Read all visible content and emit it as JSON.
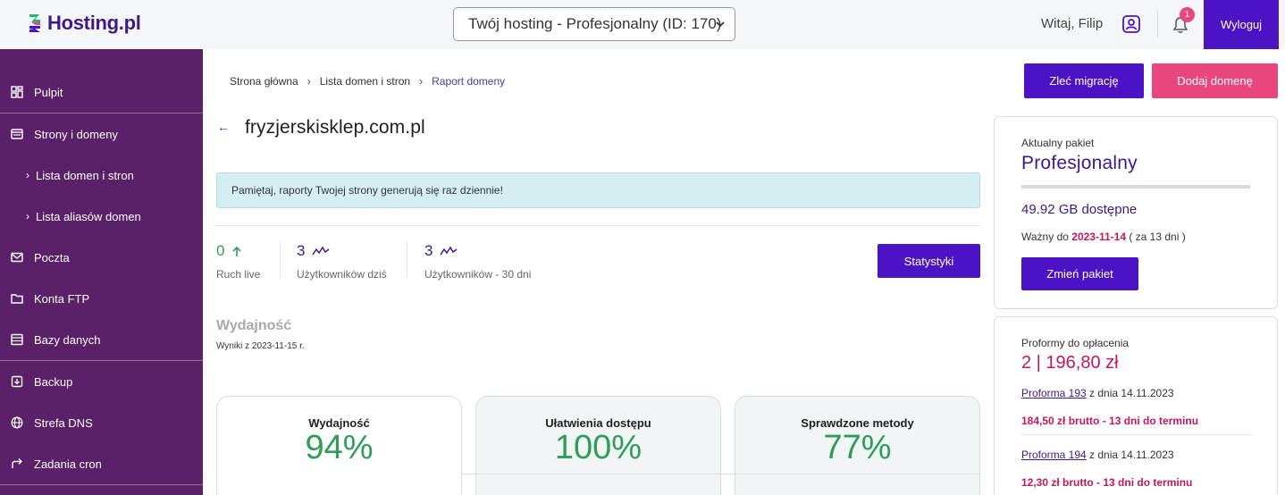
{
  "header": {
    "logo_text": "Hosting.pl",
    "hosting_select": "Twój hosting - Profesjonalny (ID: 170)",
    "greeting": "Witaj, Filip",
    "notifications_count": "1",
    "logout_label": "Wyloguj"
  },
  "sidebar": {
    "items": [
      {
        "label": "Pulpit",
        "icon": "dashboard-icon"
      },
      {
        "label": "Strony i domeny",
        "icon": "pages-icon"
      },
      {
        "label": "Lista domen i stron",
        "icon": "chevron-right-icon"
      },
      {
        "label": "Lista aliasów domen",
        "icon": "chevron-right-icon"
      },
      {
        "label": "Poczta",
        "icon": "mail-icon"
      },
      {
        "label": "Konta FTP",
        "icon": "folder-icon"
      },
      {
        "label": "Bazy danych",
        "icon": "database-icon"
      },
      {
        "label": "Backup",
        "icon": "backup-icon"
      },
      {
        "label": "Strefa DNS",
        "icon": "globe-icon"
      },
      {
        "label": "Zadania cron",
        "icon": "redirect-icon"
      }
    ]
  },
  "breadcrumb": {
    "home": "Strona główna",
    "list": "Lista domen i stron",
    "current": "Raport domeny"
  },
  "actions": {
    "migration_label": "Zleć migrację",
    "add_domain_label": "Dodaj domenę"
  },
  "domain": {
    "name": "fryzjerskisklep.com.pl",
    "notice": "Pamiętaj, raporty Twojej strony generują się raz dziennie!"
  },
  "stats": {
    "live_value": "0",
    "live_caption": "Ruch live",
    "today_value": "3",
    "today_caption": "Użytkowników dziś",
    "month_value": "3",
    "month_caption": "Użytkowników - 30 dni",
    "button_label": "Statystyki"
  },
  "performance": {
    "title": "Wydajność",
    "date": "Wyniki z 2023-11-15 r.",
    "scores": [
      {
        "label": "Wydajność",
        "value": "94%"
      },
      {
        "label": "Ułatwienia dostępu",
        "value": "100%"
      },
      {
        "label": "Sprawdzone metody",
        "value": "77%"
      }
    ]
  },
  "plan": {
    "label": "Aktualny pakiet",
    "name": "Profesjonalny",
    "usage_fraction": 0,
    "space": "49.92 GB dostępne",
    "valid_prefix": "Ważny do",
    "valid_date": "2023-11-14",
    "valid_suffix": "( za 13 dni )",
    "change_label": "Zmień pakiet"
  },
  "proforma": {
    "label": "Proformy do opłacenia",
    "total": "2 | 196,80 zł",
    "items": [
      {
        "link": "Proforma 193",
        "date": "z dnia 14.11.2023",
        "amount": "184,50 zł brutto - 13 dni do terminu"
      },
      {
        "link": "Proforma 194",
        "date": "z dnia 14.11.2023",
        "amount": "12,30 zł brutto - 13 dni do terminu"
      }
    ]
  },
  "colors": {
    "brand": "#4c13c4",
    "sidebar": "#5a2068",
    "accent_pink": "#e8467c",
    "success": "#2e9d57"
  }
}
